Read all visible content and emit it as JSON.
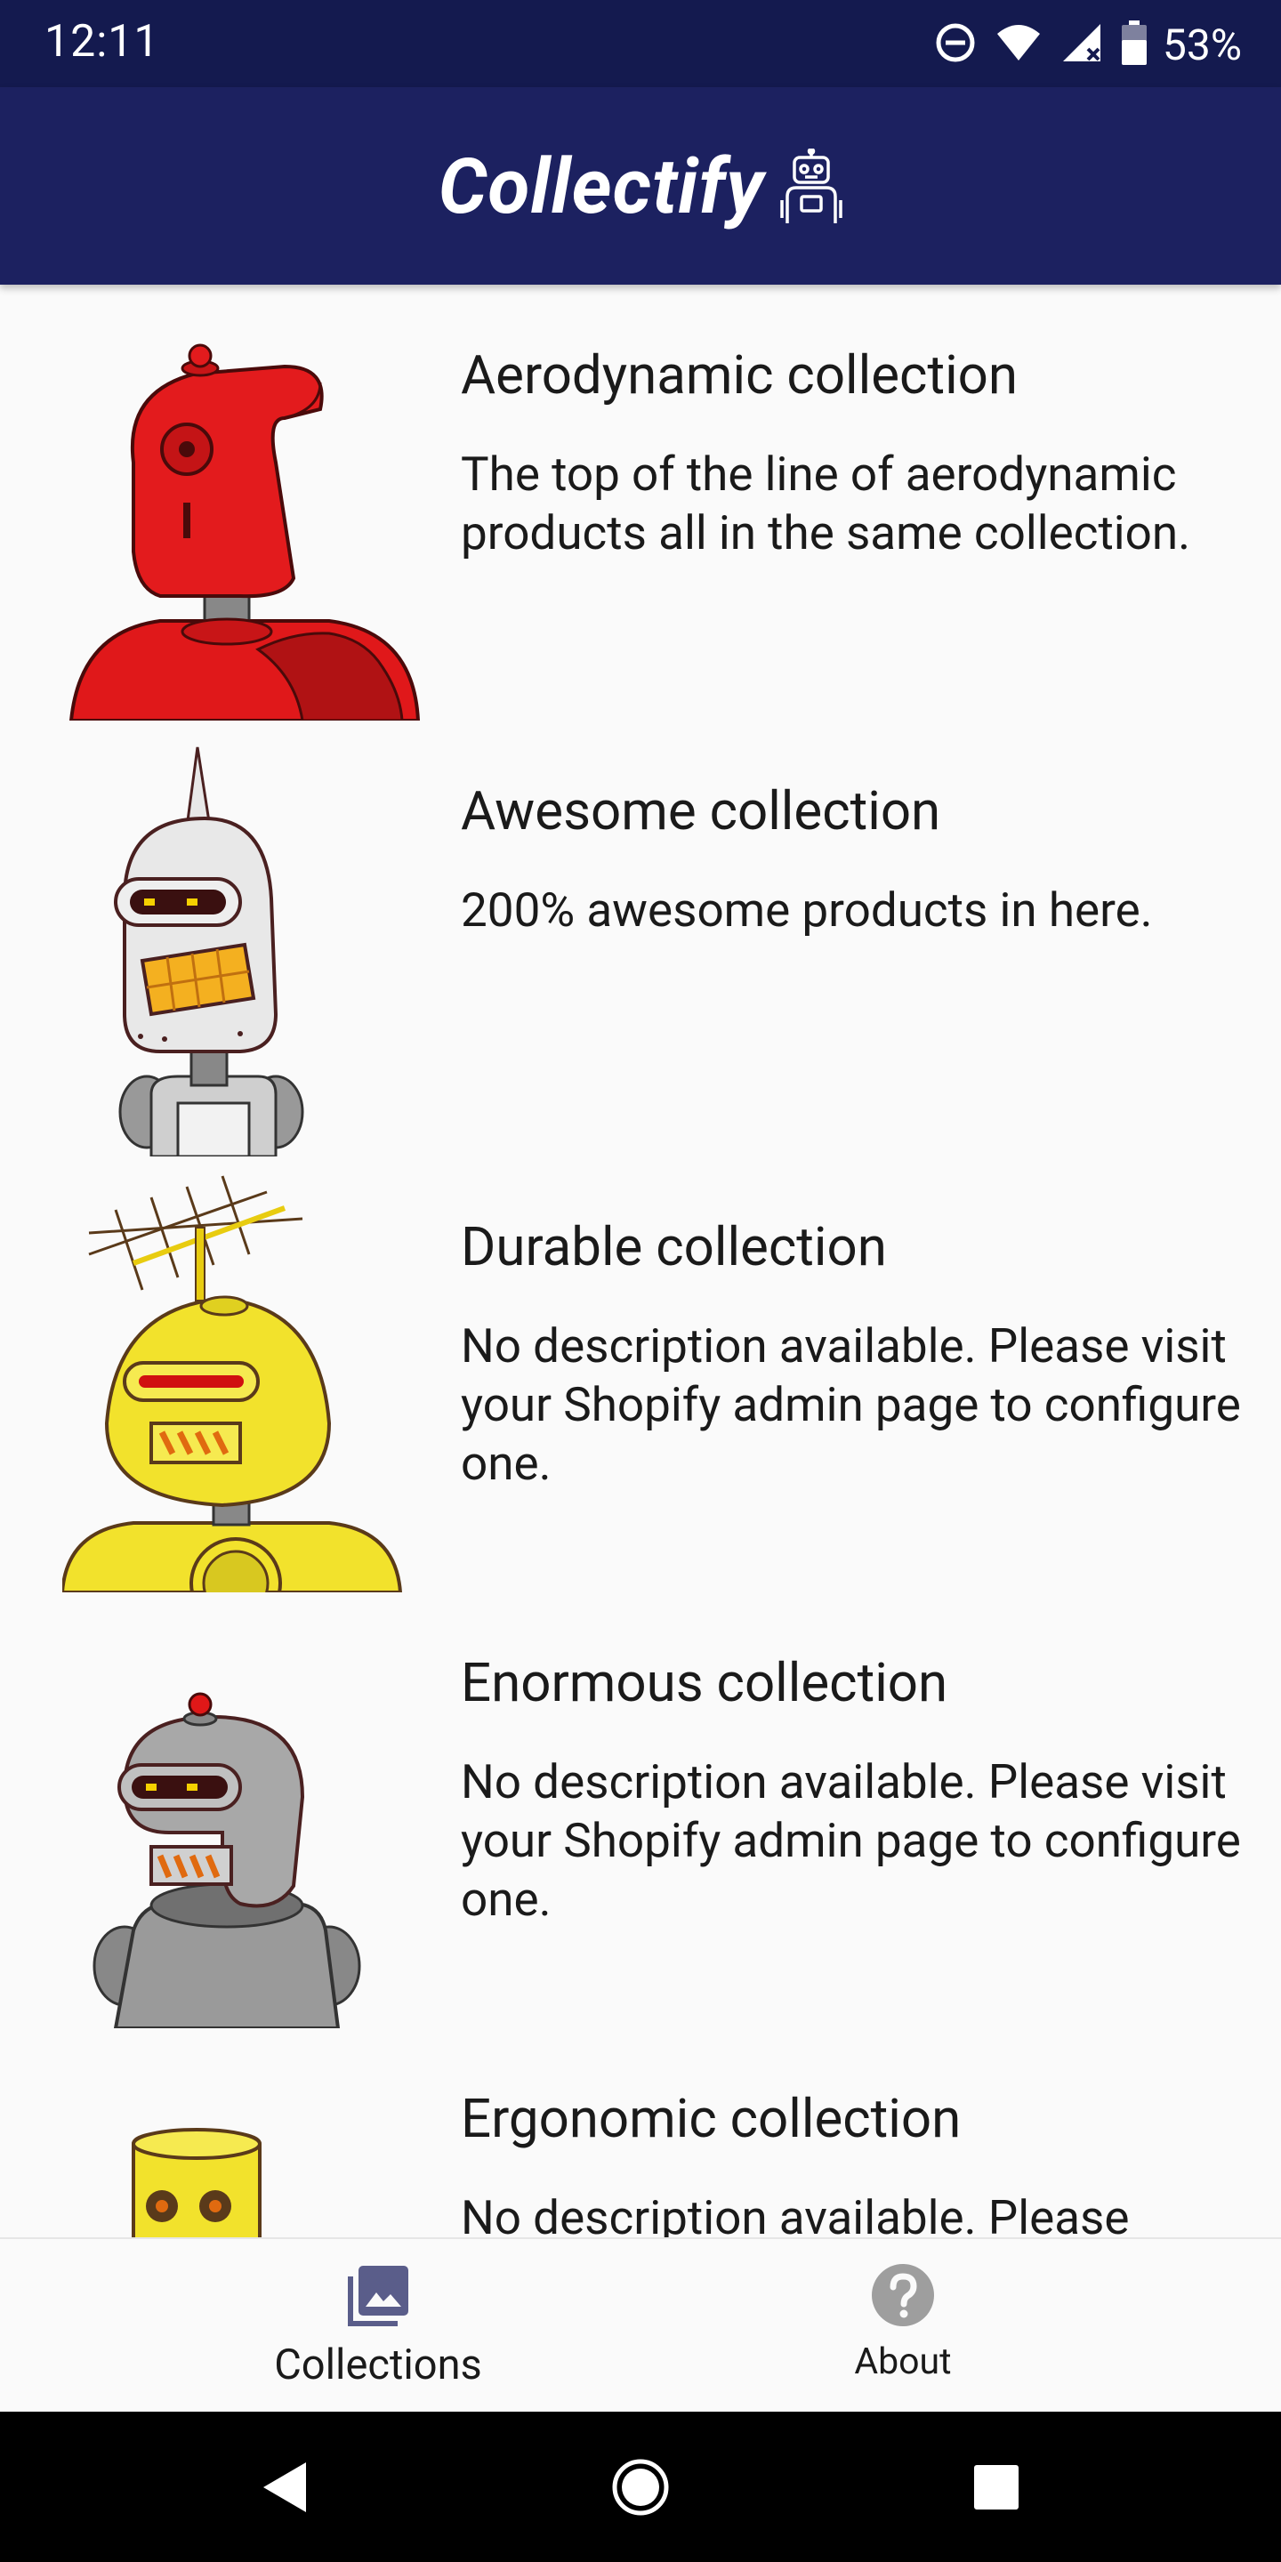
{
  "status_bar": {
    "time": "12:11",
    "battery_percent": "53%",
    "icons": [
      "do-not-disturb-icon",
      "wifi-icon",
      "cell-signal-icon",
      "battery-icon"
    ]
  },
  "app_bar": {
    "title": "Collectify",
    "logo_icon": "robot-icon",
    "background_color": "#1c2160"
  },
  "collections": [
    {
      "title": "Aerodynamic collection",
      "description": "The top of the line of aerodynamic products all in the same collection.",
      "image_icon": "red-robot-icon"
    },
    {
      "title": "Awesome collection",
      "description": "200% awesome products in here.",
      "image_icon": "white-robot-icon"
    },
    {
      "title": "Durable collection",
      "description": "No description available. Please visit your Shopify admin page to configure one.",
      "image_icon": "yellow-antenna-robot-icon"
    },
    {
      "title": "Enormous collection",
      "description": "No description available. Please visit your Shopify admin page to configure one.",
      "image_icon": "gray-robot-icon"
    },
    {
      "title": "Ergonomic collection",
      "description": "No description available. Please",
      "image_icon": "yellow-robot-icon"
    }
  ],
  "bottom_nav": {
    "tabs": [
      {
        "label": "Collections",
        "icon": "photo-library-icon",
        "active": true,
        "color": "#5a5d8a"
      },
      {
        "label": "About",
        "icon": "help-circle-icon",
        "active": false,
        "color": "#9e9e9e"
      }
    ]
  },
  "system_nav": {
    "buttons": [
      "back-icon",
      "home-icon",
      "recents-icon"
    ]
  }
}
